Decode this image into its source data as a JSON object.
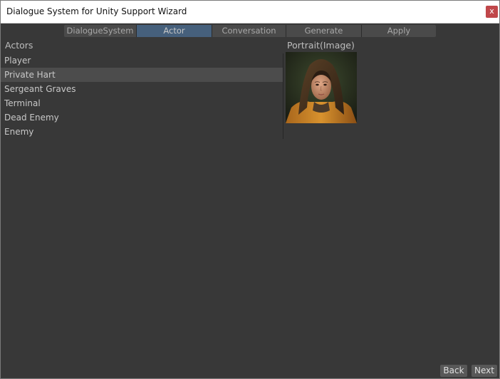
{
  "window": {
    "title": "Dialogue System for Unity Support Wizard",
    "close_label": "x"
  },
  "tabs": [
    {
      "label": "DialogueSystem",
      "active": false
    },
    {
      "label": "Actor",
      "active": true
    },
    {
      "label": "Conversation",
      "active": false
    },
    {
      "label": "Generate",
      "active": false
    },
    {
      "label": "Apply",
      "active": false
    }
  ],
  "actors": {
    "header": "Actors",
    "items": [
      {
        "label": "Player",
        "selected": false
      },
      {
        "label": "Private Hart",
        "selected": true
      },
      {
        "label": "Sergeant Graves",
        "selected": false
      },
      {
        "label": "Terminal",
        "selected": false
      },
      {
        "label": "Dead Enemy",
        "selected": false
      },
      {
        "label": "Enemy",
        "selected": false
      }
    ]
  },
  "portrait": {
    "label": "Portrait(Image)"
  },
  "footer": {
    "back_label": "Back",
    "next_label": "Next"
  },
  "colors": {
    "background": "#383838",
    "tab_active": "#46607c",
    "selected_row": "#4c4c4c",
    "close_button": "#c0474a"
  }
}
